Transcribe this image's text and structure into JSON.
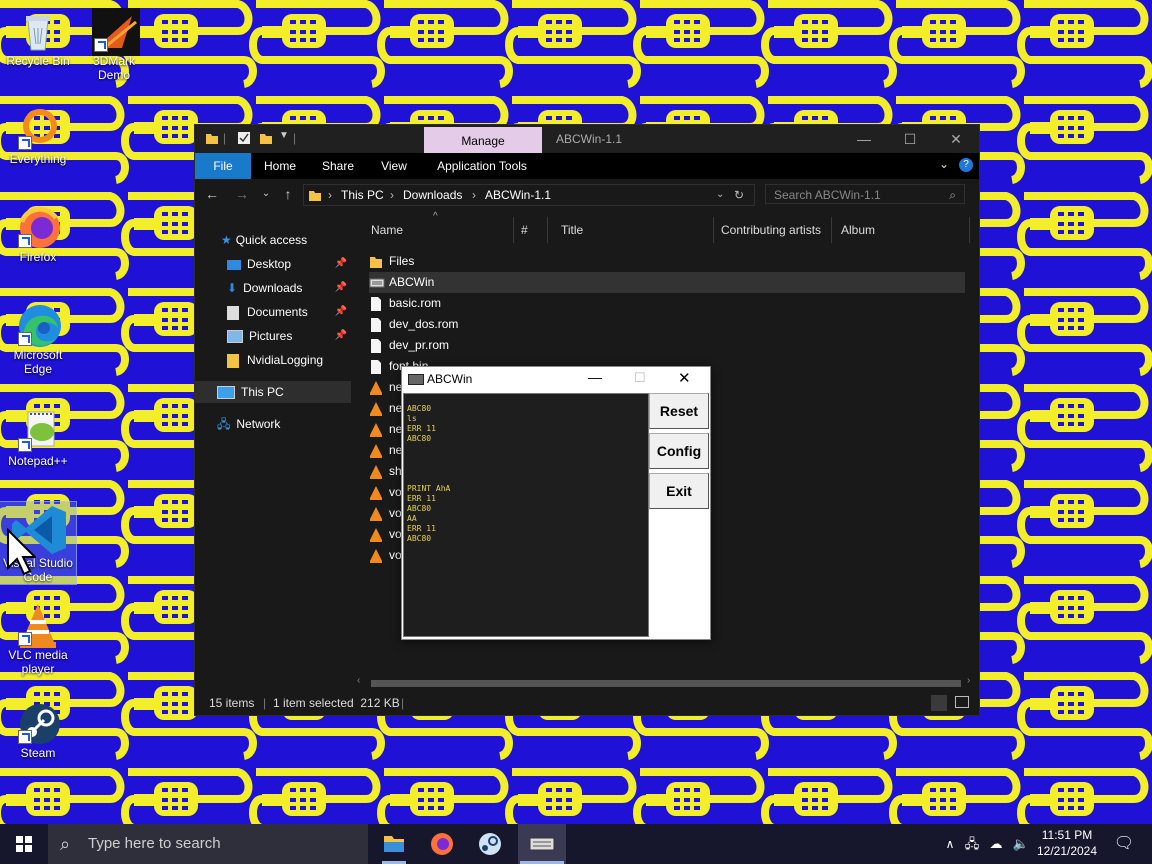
{
  "desktop": {
    "icons": [
      {
        "name": "Recycle Bin",
        "icon": "recycle-bin-icon"
      },
      {
        "name": "3DMark Demo",
        "icon": "3dmark-icon"
      },
      {
        "name": "Everything",
        "icon": "everything-icon"
      },
      {
        "name": "Firefox",
        "icon": "firefox-icon"
      },
      {
        "name": "Microsoft Edge",
        "icon": "edge-icon"
      },
      {
        "name": "Notepad++",
        "icon": "notepadpp-icon"
      },
      {
        "name": "Visual Studio Code",
        "icon": "vscode-icon"
      },
      {
        "name": "VLC media player",
        "icon": "vlc-icon"
      },
      {
        "name": "Steam",
        "icon": "steam-icon"
      }
    ],
    "wallpaper_colors": {
      "background": "#1f12d6",
      "pattern": "#f3ee2a"
    }
  },
  "explorer": {
    "manage_tab": "Manage",
    "title": "ABCWin-1.1",
    "ribbon_tabs": [
      "File",
      "Home",
      "Share",
      "View",
      "Application Tools"
    ],
    "breadcrumb": [
      "This PC",
      "Downloads",
      "ABCWin-1.1"
    ],
    "search_placeholder": "Search ABCWin-1.1",
    "nav": {
      "quick_access": "Quick access",
      "items": [
        "Desktop",
        "Downloads",
        "Documents",
        "Pictures",
        "NvidiaLogging"
      ],
      "this_pc": "This PC",
      "network": "Network"
    },
    "columns": [
      "Name",
      "#",
      "Title",
      "Contributing artists",
      "Album"
    ],
    "files": [
      {
        "name": "Files",
        "type": "folder"
      },
      {
        "name": "ABCWin",
        "type": "app"
      },
      {
        "name": "basic.rom",
        "type": "file"
      },
      {
        "name": "dev_dos.rom",
        "type": "file"
      },
      {
        "name": "dev_pr.rom",
        "type": "file"
      },
      {
        "name": "font.bin",
        "type": "file"
      },
      {
        "name": "ne",
        "type": "vlc"
      },
      {
        "name": "ne",
        "type": "vlc"
      },
      {
        "name": "ne",
        "type": "vlc"
      },
      {
        "name": "ne",
        "type": "vlc"
      },
      {
        "name": "sh",
        "type": "vlc"
      },
      {
        "name": "vo",
        "type": "vlc"
      },
      {
        "name": "vo",
        "type": "vlc"
      },
      {
        "name": "vo",
        "type": "vlc"
      },
      {
        "name": "vo",
        "type": "vlc"
      }
    ],
    "status": {
      "items": "15 items",
      "selected": "1 item selected  212 KB"
    }
  },
  "abcwin": {
    "title": "ABCWin",
    "terminal_text": "ABC80\nls\nERR 11\nABC80\n\n\n\n\nPRINT AhA\nERR 11\nABC80\nAA\nERR 11\nABC80",
    "buttons": {
      "reset": "Reset",
      "config": "Config",
      "exit": "Exit"
    }
  },
  "taskbar": {
    "search_placeholder": "Type here to search",
    "time": "11:51 PM",
    "date": "12/21/2024"
  }
}
